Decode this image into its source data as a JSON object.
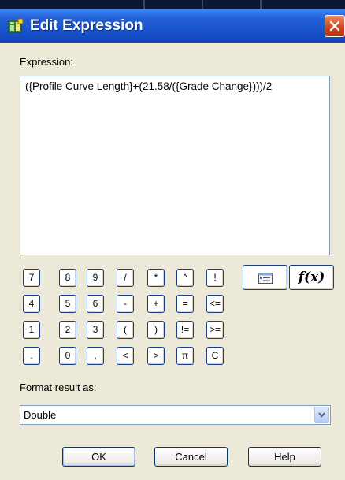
{
  "window": {
    "title": "Edit Expression"
  },
  "expression": {
    "label": "Expression:",
    "value": "({Profile Curve Length}+(21.58/({Grade Change})))/2"
  },
  "keypad": {
    "rows": [
      [
        "7",
        "8",
        "9",
        "/",
        "*",
        "^",
        "!"
      ],
      [
        "4",
        "5",
        "6",
        "-",
        "+",
        "=",
        "<="
      ],
      [
        "1",
        "2",
        "3",
        "(",
        ")",
        "!=",
        ">="
      ],
      [
        ".",
        "0",
        ",",
        "<",
        ">",
        "π",
        "C"
      ]
    ],
    "properties_icon": "properties-list-icon",
    "function_label": "f(x)"
  },
  "format": {
    "label": "Format result as:",
    "selected": "Double"
  },
  "buttons": {
    "ok": "OK",
    "cancel": "Cancel",
    "help": "Help"
  },
  "colors": {
    "titlebar": "#1a55cf",
    "close": "#d0421c",
    "background": "#ece9d8"
  }
}
